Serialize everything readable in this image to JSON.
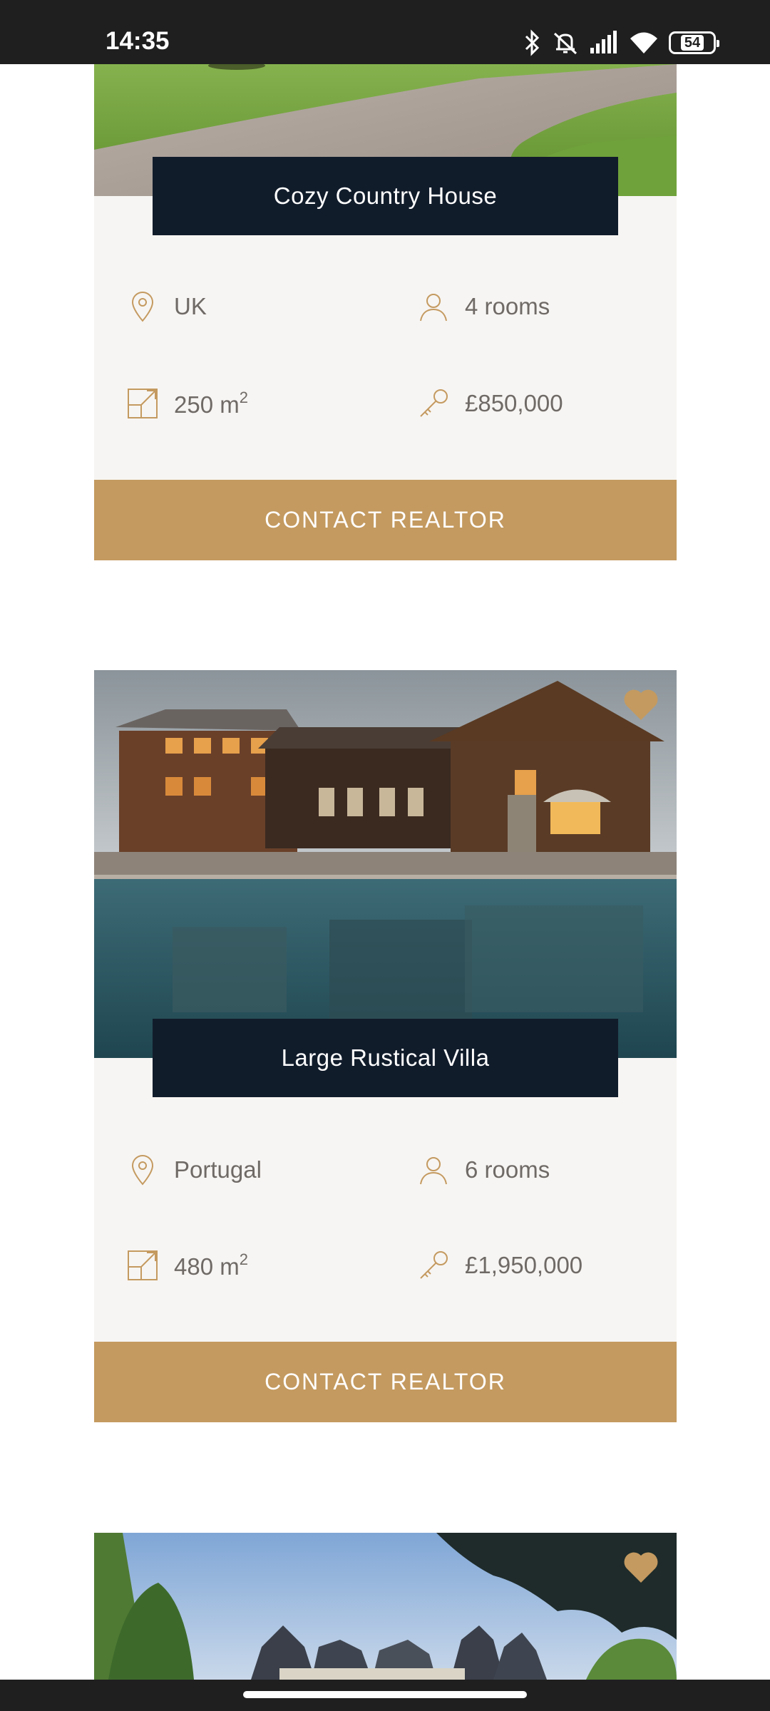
{
  "status_bar": {
    "time": "14:35",
    "battery": "54",
    "icons": [
      "bluetooth-icon",
      "mute-icon",
      "signal-icon",
      "wifi-icon",
      "battery-icon"
    ]
  },
  "colors": {
    "accent": "#c49a60",
    "title_bg": "#111c2b",
    "card_bg": "#f7f5f3",
    "text": "#6f6a66"
  },
  "listings": [
    {
      "title": "Cozy Country House",
      "location": "UK",
      "rooms": "4 rooms",
      "area_value": "250 m",
      "area_unit_sup": "2",
      "price": "£850,000",
      "button_label": "CONTACT REALTOR"
    },
    {
      "title": "Large Rustical Villa",
      "location": "Portugal",
      "rooms": "6 rooms",
      "area_value": "480 m",
      "area_unit_sup": "2",
      "price": "£1,950,000",
      "button_label": "CONTACT REALTOR"
    },
    {
      "title": "",
      "location": "",
      "rooms": "",
      "price": ""
    }
  ]
}
